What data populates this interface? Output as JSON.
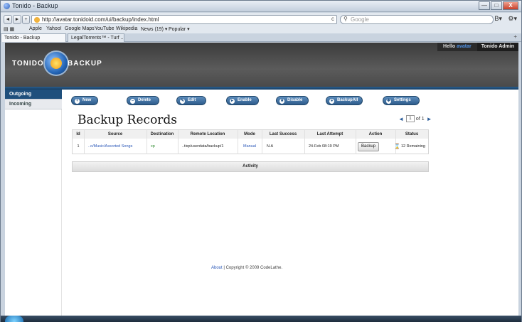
{
  "window": {
    "title": "Tonido - Backup",
    "controls": {
      "minimize": "—",
      "maximize": "□",
      "close": "X"
    }
  },
  "browser": {
    "back": "◄",
    "forward": "►",
    "new_tab": "+",
    "url": "http://avatar.tonidoid.com/ui/backup/index.html",
    "reload": "c",
    "search_placeholder": "Google",
    "search_icon": "magnifier-icon",
    "tools": [
      "B▾",
      "⚙▾"
    ]
  },
  "bookmarks": [
    "Apple",
    "Yahoo!",
    "Google Maps",
    "YouTube",
    "Wikipedia",
    "News (19) ▾",
    "Popular ▾"
  ],
  "tabs": [
    {
      "label": "Tonido - Backup",
      "active": true
    },
    {
      "label": "LegalTorrents™ - Turf ...",
      "active": false
    }
  ],
  "header": {
    "brand_left": "TONIDO",
    "brand_right": "BACKUP",
    "hello_prefix": "Hello",
    "username": "avatar",
    "admin_link": "Tonido Admin"
  },
  "sidebar": {
    "items": [
      "Outgoing",
      "Incoming"
    ]
  },
  "toolbar": {
    "buttons": [
      {
        "label": "New",
        "icon": "plus-icon"
      },
      {
        "label": "Delete",
        "icon": "minus-icon"
      },
      {
        "label": "Edit",
        "icon": "edit-icon"
      },
      {
        "label": "Enable",
        "icon": "play-icon"
      },
      {
        "label": "Disable",
        "icon": "stop-icon"
      },
      {
        "label": "BackupAll",
        "icon": "backup-icon"
      },
      {
        "label": "Settings",
        "icon": "gear-icon"
      }
    ]
  },
  "main": {
    "title": "Backup Records",
    "pager": {
      "current": "1",
      "of_text": "of 1"
    }
  },
  "records": {
    "columns": [
      "Id",
      "Source",
      "Destination",
      "Remote Location",
      "Mode",
      "Last Success",
      "Last Attempt",
      "Action",
      "Status"
    ],
    "rows": [
      {
        "id": "1",
        "source": "..o/Music/Assorted Songs",
        "destination": "xp",
        "remote_location": "..tixp/userdata/backup/1",
        "mode": "Manual",
        "last_success": "N.A",
        "last_attempt": "24-Feb 08:19 PM",
        "action": "Backup",
        "status": "12 Remaining"
      }
    ]
  },
  "activity": {
    "title": "Activity"
  },
  "footer": {
    "about": "About",
    "separator": "|",
    "copyright": "Copyright © 2009 CodeLathe."
  },
  "colors": {
    "accent": "#1f4f7c",
    "link": "#2a57b8",
    "header_bg": "#4a4a4a",
    "username": "#4f92e6"
  }
}
